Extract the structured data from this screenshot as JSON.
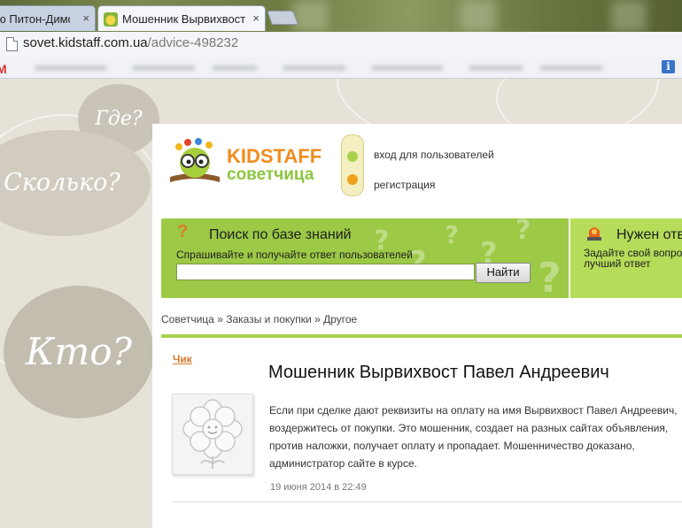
{
  "browser": {
    "tabs": [
      {
        "title": "ю Питон-Димо",
        "active": false
      },
      {
        "title": "Мошенник Вырвихвост П",
        "active": true
      }
    ],
    "close_glyph": "×",
    "url_host": "sovet.kidstaff.com.ua",
    "url_path": "/advice-498232"
  },
  "bookmarks": {
    "info_glyph": "i"
  },
  "background": {
    "bubbles": [
      "Где?",
      "Сколько?",
      "Кто?"
    ]
  },
  "header": {
    "logo_top": "KIDSTAFF",
    "logo_bottom": "советчица",
    "login_link": "вход для пользователей",
    "register_link": "регистрация"
  },
  "search": {
    "title": "Поиск по базе знаний",
    "subtitle": "Спрашивайте и получайте ответ пользователей",
    "input_value": "",
    "button_label": "Найти"
  },
  "urgent": {
    "title": "Нужен отв",
    "subtitle_line1": "Задайте свой вопро",
    "subtitle_line2": "лучший ответ"
  },
  "breadcrumb": {
    "items": [
      "Советчица",
      "Заказы и покупки",
      "Другое"
    ],
    "separator": "»"
  },
  "post": {
    "author": "Чик",
    "title": "Мошенник Вырвихвост Павел Андреевич",
    "body": "Если при сделке дают реквизиты на оплату на имя Вырвихвост Павел Андреевич, воздержитесь от покупки. Это мошенник, создает на разных сайтах объявления, против наложки, получает оплату и пропадает. Мошенничество доказано, администратор сайте в курсе.",
    "date": "19 июня 2014 в 22:49"
  },
  "colors": {
    "search_green": "#9cc946",
    "urgent_green": "#b6dc5a",
    "author_orange": "#d97a2a",
    "page_bg": "#e6e2d8"
  }
}
